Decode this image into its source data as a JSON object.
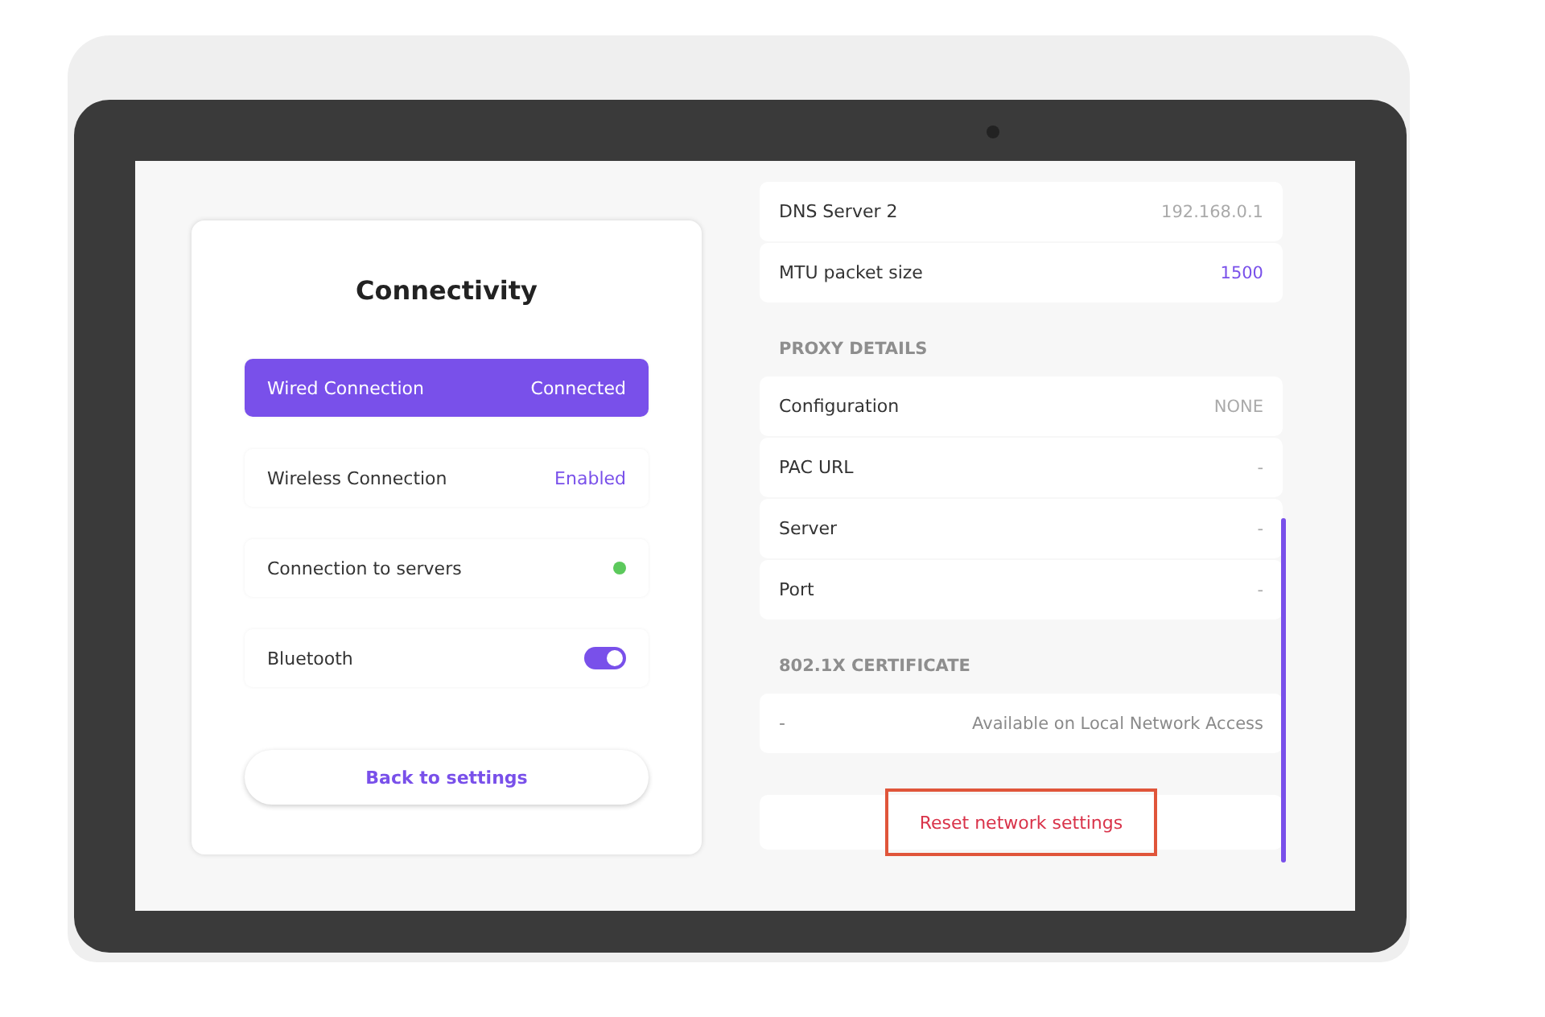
{
  "connectivity": {
    "title": "Connectivity",
    "items": [
      {
        "kind": "status",
        "label": "Wired Connection",
        "value": "Connected",
        "selected": true
      },
      {
        "kind": "status",
        "label": "Wireless Connection",
        "value": "Enabled",
        "selected": false
      },
      {
        "kind": "dot",
        "label": "Connection to servers",
        "color": "#5cc95c",
        "selected": false
      },
      {
        "kind": "toggle",
        "label": "Bluetooth",
        "on": true,
        "selected": false
      }
    ],
    "back_button": "Back to settings"
  },
  "details": [
    {
      "rows": [
        {
          "label": "DNS Server 2",
          "value": "192.168.0.1",
          "emphasized": false
        },
        {
          "label": "MTU packet size",
          "value": "1500",
          "emphasized": true
        }
      ]
    },
    {
      "heading": "PROXY DETAILS",
      "rows": [
        {
          "label": "Configuration",
          "value": "NONE",
          "emphasized": false
        },
        {
          "label": "PAC URL",
          "value": "-",
          "emphasized": false
        },
        {
          "label": "Server",
          "value": "-",
          "emphasized": false
        },
        {
          "label": "Port",
          "value": "-",
          "emphasized": false
        }
      ]
    },
    {
      "heading": "802.1X CERTIFICATE",
      "certificate": {
        "label": "-",
        "value": "Available on Local Network Access"
      }
    }
  ],
  "reset_button": {
    "label": "Reset network settings",
    "outlined": true
  }
}
